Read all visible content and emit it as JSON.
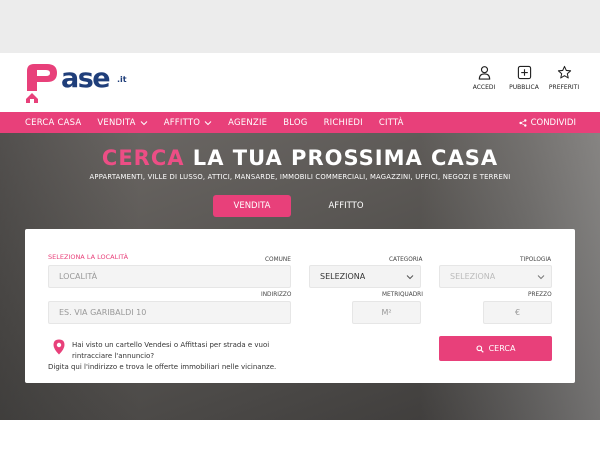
{
  "brand": {
    "logo_text": "Pcase",
    "logo_tld": ".it",
    "pink": "#e8407a",
    "navy": "#1f3e7a"
  },
  "header_actions": [
    {
      "label": "ACCEDI",
      "icon": "user-icon"
    },
    {
      "label": "PUBBLICA",
      "icon": "plus-square-icon"
    },
    {
      "label": "PREFERITI",
      "icon": "star-icon"
    }
  ],
  "nav": {
    "items": [
      {
        "label": "CERCA CASA",
        "has_dropdown": false
      },
      {
        "label": "VENDITA",
        "has_dropdown": true
      },
      {
        "label": "AFFITTO",
        "has_dropdown": true
      },
      {
        "label": "AGENZIE",
        "has_dropdown": false
      },
      {
        "label": "BLOG",
        "has_dropdown": false
      },
      {
        "label": "RICHIEDI",
        "has_dropdown": false
      },
      {
        "label": "CITTÀ",
        "has_dropdown": false
      }
    ],
    "share_label": "CONDIVIDI",
    "share_icon": "share-icon"
  },
  "hero": {
    "title_accent": "CERCA",
    "title_rest": " LA TUA PROSSIMA CASA",
    "subtitle": "APPARTAMENTI, VILLE DI LUSSO, ATTICI, MANSARDE, IMMOBILI COMMERCIALI, MAGAZZINI, UFFICI, NEGOZI E TERRENI",
    "tabs": [
      {
        "label": "VENDITA",
        "active": true
      },
      {
        "label": "AFFITTO",
        "active": false
      }
    ]
  },
  "search_form": {
    "location_heading": "SELEZIONA LA LOCALITÀ",
    "comune_label": "COMUNE",
    "comune_placeholder": "LOCALITÀ",
    "categoria_label": "CATEGORIA",
    "categoria_value": "SELEZIONA",
    "tipologia_label": "TIPOLOGIA",
    "tipologia_value": "SELEZIONA",
    "indirizzo_label": "INDIRIZZO",
    "indirizzo_placeholder": "ES. VIA GARIBALDI 10",
    "metriquadri_label": "METRIQUADRI",
    "metriquadri_placeholder": "M²",
    "prezzo_label": "PREZZO",
    "prezzo_placeholder": "€",
    "info_line1": "Hai visto un cartello Vendesi o Affittasi per strada e vuoi",
    "info_line2": "rintracciare l'annuncio?",
    "info_line3": "Digita qui l'indirizzo e trova le offerte immobiliari nelle vicinanze.",
    "search_button": "CERCA",
    "search_icon": "search-icon",
    "pin_icon": "map-pin-icon"
  }
}
